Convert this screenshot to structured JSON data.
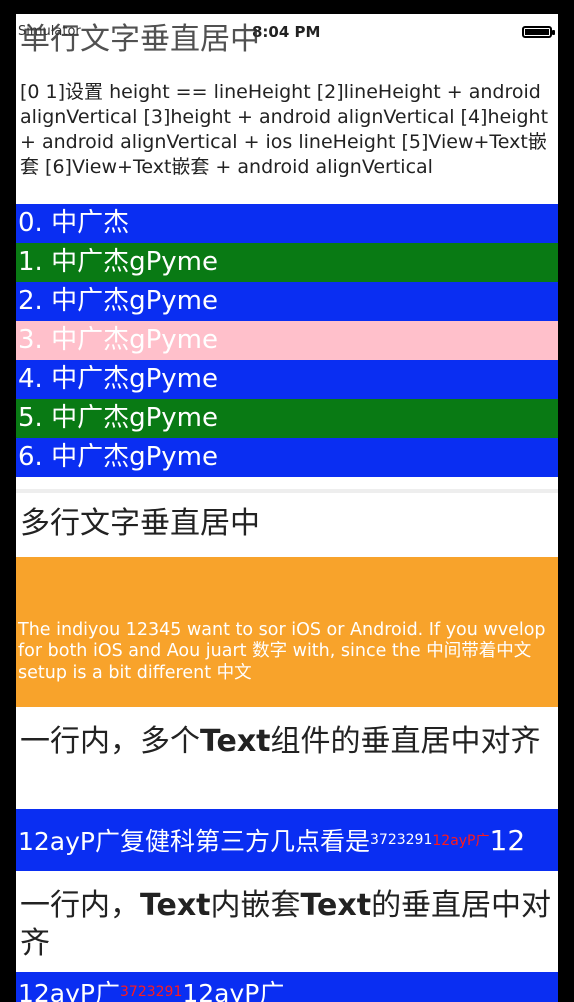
{
  "status": {
    "carrier": "Simulator",
    "time": "8:04 PM"
  },
  "section1": {
    "title": "单行文字垂直居中",
    "desc": "[0 1]设置 height == lineHeight  [2]lineHeight + android alignVertical  [3]height + android alignVertical [4]height + android alignVertical + ios lineHeight [5]View+Text嵌套  [6]View+Text嵌套 + android alignVertical",
    "rows": [
      {
        "label": "0. 中广杰",
        "color": "#0a2ef2"
      },
      {
        "label": "1. 中广杰gPyme",
        "color": "#097a14"
      },
      {
        "label": "2. 中广杰gPyme",
        "color": "#0a2ef2"
      },
      {
        "label": "3. 中广杰gPyme",
        "color": "#ffc0cb"
      },
      {
        "label": "4. 中广杰gPyme",
        "color": "#0a2ef2"
      },
      {
        "label": "5. 中广杰gPyme",
        "color": "#097a14"
      },
      {
        "label": "6. 中广杰gPyme",
        "color": "#0a2ef2"
      }
    ]
  },
  "section2": {
    "title": "多行文字垂直居中",
    "body": "The indiyou 12345 want to sor iOS or Android. If you wvelop for both iOS and Aou juart 数字 with, since the 中间带着中文 setup is a bit different 中文"
  },
  "section3": {
    "title": "一行内，多个Text组件的垂直居中对齐",
    "title_plain": "一行内，多个",
    "title_bold": "Text",
    "title_rest": "组件的垂直居中对齐",
    "parts": [
      "12ayP广复健科第三方几点看是",
      "3723291",
      "12ayP广",
      "12"
    ]
  },
  "section4": {
    "title_plain": "一行内，",
    "title_bold1": "Text",
    "title_mid": "内嵌套",
    "title_bold2": "Text",
    "title_rest": "的垂直居中对齐",
    "parts": [
      "12ayP广",
      "3723291",
      "12ayP广"
    ]
  }
}
